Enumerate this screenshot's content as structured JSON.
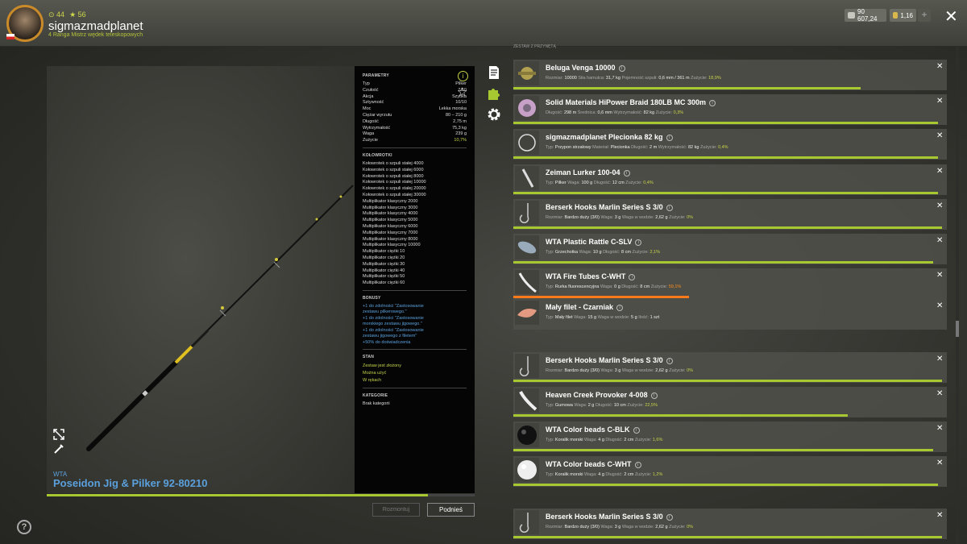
{
  "header": {
    "level": "44",
    "stars": "56",
    "username": "sigmazmadplanet",
    "rank": "4 Ranga Mistrz wędek teleskopowych",
    "currency_silver": "90 607,24",
    "currency_gold": "1,16",
    "plus_label": "+",
    "close_label": "✕"
  },
  "item": {
    "brand": "WTA",
    "title": "Poseidon Jig & Pilker 92-80210",
    "progress_fraction": 0.89
  },
  "params": {
    "heading": "PARAMETRY",
    "rows": [
      {
        "k": "Typ",
        "v": "Pilker"
      },
      {
        "k": "Czułość",
        "v": "7/10"
      },
      {
        "k": "Akcja",
        "v": "Szybka"
      },
      {
        "k": "Sztywność",
        "v": "10/10"
      },
      {
        "k": "Moc",
        "v": "Lekka morska"
      },
      {
        "k": "Ciężar wyrzutu",
        "v": "80 – 210 g"
      },
      {
        "k": "Długość",
        "v": "2,75 m"
      },
      {
        "k": "Wytrzymałość",
        "v": "75,3 kg"
      },
      {
        "k": "Waga",
        "v": "239 g"
      },
      {
        "k": "Zużycie",
        "v": "10,7%"
      }
    ]
  },
  "reels": {
    "heading": "KOŁOWROTKI",
    "items": [
      "Kołowrotek o szpuli stałej 4000",
      "Kołowrotek o szpuli stałej 6000",
      "Kołowrotek o szpuli stałej 8000",
      "Kołowrotek o szpuli stałej 10000",
      "Kołowrotek o szpuli stałej 20000",
      "Kołowrotek o szpuli stałej 30000",
      "Multiplikator klasyczny 2000",
      "Multiplikator klasyczny 3000",
      "Multiplikator klasyczny 4000",
      "Multiplikator klasyczny 5000",
      "Multiplikator klasyczny 6000",
      "Multiplikator klasyczny 7000",
      "Multiplikator klasyczny 8000",
      "Multiplikator klasyczny 10000",
      "Multiplikator ciężki 10",
      "Multiplikator ciężki 20",
      "Multiplikator ciężki 30",
      "Multiplikator ciężki 40",
      "Multiplikator ciężki 50",
      "Multiplikator ciężki 60"
    ]
  },
  "bonuses": {
    "heading": "BONUSY",
    "items": [
      "+1 do zdolności \"Zastosowanie",
      "zestawu pilkerowego.\"",
      "+1 do zdolności \"Zastosowanie",
      "morskiego zestawu jigowego.\"",
      "+1 do zdolności \"Zastosowanie",
      "zestawu jigowego z filetem\"",
      "+50% do doświadczenia"
    ]
  },
  "state": {
    "heading": "STAN",
    "items": [
      "Zestaw jest złożony",
      "Można użyć",
      "W rękach"
    ]
  },
  "categories": {
    "heading": "KATEGORIE",
    "value": "Brak kategorii"
  },
  "buttons": {
    "dismount": "Rozmontuj",
    "pickup": "Podnieś"
  },
  "list_header": "ZESTAW Z PRZYNĘTĄ",
  "list": [
    {
      "name": "Beluga Venga 10000",
      "det": [
        [
          "Rozmiar:",
          "10000"
        ],
        [
          "Siła hamulca:",
          "31,7 kg"
        ],
        [
          "Pojemność szpuli:",
          "0,6 mm / 361 m"
        ],
        [
          "Zużycie:",
          "18,9%",
          "g"
        ]
      ],
      "wear": 0.81,
      "icon": "reel-icon"
    },
    {
      "name": "Solid Materials HiPower Braid 180LB MC 300m",
      "det": [
        [
          "Długość:",
          "298 m"
        ],
        [
          "Średnica:",
          "0,6 mm"
        ],
        [
          "Wytrzymałość:",
          "82 kg"
        ],
        [
          "Zużycie:",
          "0,3%",
          "g"
        ]
      ],
      "wear": 0.99,
      "icon": "line-spool-icon"
    },
    {
      "name": "sigmazmadplanet Plecionka 82 kg",
      "det": [
        [
          "Typ:",
          "Przypon strzałowy"
        ],
        [
          "Materiał:",
          "Plecionka"
        ],
        [
          "Długość:",
          "2 m"
        ],
        [
          "Wytrzymałość:",
          "82 kg"
        ],
        [
          "Zużycie:",
          "0,4%",
          "g"
        ]
      ],
      "wear": 0.99,
      "icon": "leader-icon"
    },
    {
      "name": "Zeiman Lurker 100-04",
      "det": [
        [
          "Typ:",
          "Pilker"
        ],
        [
          "Waga:",
          "100 g"
        ],
        [
          "Długość:",
          "12 cm"
        ],
        [
          "Zużycie:",
          "0,4%",
          "g"
        ]
      ],
      "wear": 0.99,
      "icon": "pilker-icon"
    },
    {
      "name": "Berserk Hooks Marlin Series S 3/0",
      "det": [
        [
          "Rozmiar:",
          "Bardzo duży (3/0)"
        ],
        [
          "Waga:",
          "3 g"
        ],
        [
          "Waga w wodzie:",
          "2,62 g"
        ],
        [
          "Zużycie:",
          "0%",
          "g"
        ]
      ],
      "wear": 1.0,
      "icon": "hook-icon"
    },
    {
      "name": "WTA Plastic Rattle C-SLV",
      "det": [
        [
          "Typ:",
          "Grzechotka"
        ],
        [
          "Waga:",
          "10 g"
        ],
        [
          "Długość:",
          "8 cm"
        ],
        [
          "Zużycie:",
          "2,1%",
          "g"
        ]
      ],
      "wear": 0.98,
      "icon": "rattle-icon"
    },
    {
      "name": "WTA Fire Tubes C-WHT",
      "det": [
        [
          "Typ:",
          "Rurka fluorescencyjna"
        ],
        [
          "Waga:",
          "0 g"
        ],
        [
          "Długość:",
          "8 cm"
        ],
        [
          "Zużycie:",
          "59,1%",
          "o"
        ]
      ],
      "wear": 0.41,
      "icon": "tube-icon",
      "orange": true
    },
    {
      "name": "Mały filet - Czarniak",
      "det": [
        [
          "Typ:",
          "Mały filet"
        ],
        [
          "Waga:",
          "15 g"
        ],
        [
          "Waga w wodzie:",
          "5 g"
        ],
        [
          "Ilość:",
          "1 szt"
        ]
      ],
      "wear": null,
      "icon": "fillet-icon"
    },
    {
      "name": "Berserk Hooks Marlin Series S 3/0",
      "det": [
        [
          "Rozmiar:",
          "Bardzo duży (3/0)"
        ],
        [
          "Waga:",
          "3 g"
        ],
        [
          "Waga w wodzie:",
          "2,62 g"
        ],
        [
          "Zużycie:",
          "0%",
          "g"
        ]
      ],
      "wear": 1.0,
      "icon": "hook-icon"
    },
    {
      "name": "Heaven Creek Provoker 4-008",
      "det": [
        [
          "Typ:",
          "Gumowa"
        ],
        [
          "Waga:",
          "2 g"
        ],
        [
          "Długość:",
          "10 cm"
        ],
        [
          "Zużycie:",
          "22,5%",
          "g"
        ]
      ],
      "wear": 0.78,
      "icon": "soft-bait-icon"
    },
    {
      "name": "WTA Color beads C-BLK",
      "det": [
        [
          "Typ:",
          "Koralik morski"
        ],
        [
          "Waga:",
          "4 g"
        ],
        [
          "Długość:",
          "2 cm"
        ],
        [
          "Zużycie:",
          "1,6%",
          "g"
        ]
      ],
      "wear": 0.98,
      "icon": "black-bead-icon"
    },
    {
      "name": "WTA Color beads C-WHT",
      "det": [
        [
          "Typ:",
          "Koralik morski"
        ],
        [
          "Waga:",
          "4 g"
        ],
        [
          "Długość:",
          "2 cm"
        ],
        [
          "Zużycie:",
          "1,2%",
          "g"
        ]
      ],
      "wear": 0.99,
      "icon": "white-bead-icon"
    },
    {
      "name": "Berserk Hooks Marlin Series S 3/0",
      "det": [
        [
          "Rozmiar:",
          "Bardzo duży (3/0)"
        ],
        [
          "Waga:",
          "3 g"
        ],
        [
          "Waga w wodzie:",
          "2,62 g"
        ],
        [
          "Zużycie:",
          "0%",
          "g"
        ]
      ],
      "wear": 1.0,
      "icon": "hook-icon"
    }
  ],
  "colors": {
    "accent": "#a8c832",
    "link": "#5aa0dc",
    "warn": "#ff7a1a"
  }
}
